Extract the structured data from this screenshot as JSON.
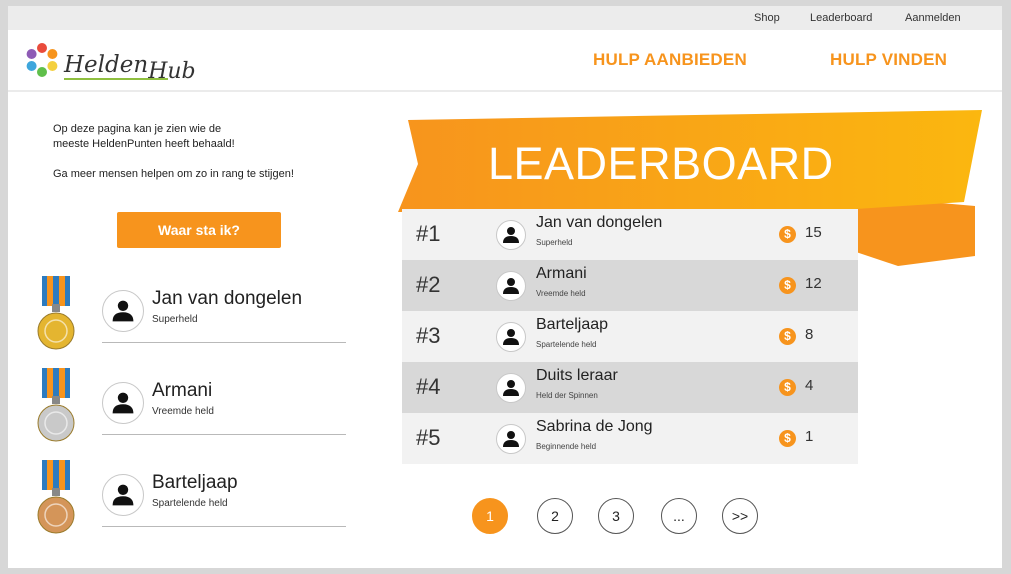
{
  "topbar": {
    "links": [
      {
        "label": "Shop",
        "name": "shop"
      },
      {
        "label": "Leaderboard",
        "name": "leaderboard"
      },
      {
        "label": "Aanmelden",
        "name": "aanmelden"
      }
    ]
  },
  "header": {
    "logo_main": "Helden",
    "logo_sub": "Hub",
    "nav": [
      {
        "label": "HULP AANBIEDEN",
        "name": "hulp-aanbieden"
      },
      {
        "label": "HULP VINDEN",
        "name": "hulp-vinden"
      }
    ]
  },
  "intro": {
    "line1": "Op deze pagina kan je zien wie de",
    "line2": "meeste HeldenPunten heeft behaald!",
    "line3": "Ga meer mensen helpen om zo in rang te stijgen!"
  },
  "where_button": "Waar sta ik?",
  "podium": [
    {
      "name": "Jan van dongelen",
      "title": "Superheld",
      "medal": "gold-medal-icon",
      "medal_color": "#e4b530"
    },
    {
      "name": "Armani",
      "title": "Vreemde held",
      "medal": "silver-medal-icon",
      "medal_color": "#c9c9c9"
    },
    {
      "name": "Barteljaap",
      "title": "Spartelende held",
      "medal": "bronze-medal-icon",
      "medal_color": "#d49559"
    }
  ],
  "leaderboard": {
    "title": "LEADERBOARD",
    "coin_symbol": "$",
    "rows": [
      {
        "rank": "#1",
        "name": "Jan van dongelen",
        "title": "Superheld",
        "points": "15"
      },
      {
        "rank": "#2",
        "name": "Armani",
        "title": "Vreemde held",
        "points": "12"
      },
      {
        "rank": "#3",
        "name": "Barteljaap",
        "title": "Spartelende held",
        "points": "8"
      },
      {
        "rank": "#4",
        "name": "Duits leraar",
        "title": "Held der Spinnen",
        "points": "4"
      },
      {
        "rank": "#5",
        "name": "Sabrina de Jong",
        "title": "Beginnende held",
        "points": "1"
      }
    ]
  },
  "pagination": {
    "pages": [
      "1",
      "2",
      "3",
      "...",
      ">>"
    ],
    "active": "1"
  },
  "colors": {
    "accent": "#f7941d",
    "banner_light": "#fbb70f",
    "row_alt": "#d8d8d8"
  }
}
